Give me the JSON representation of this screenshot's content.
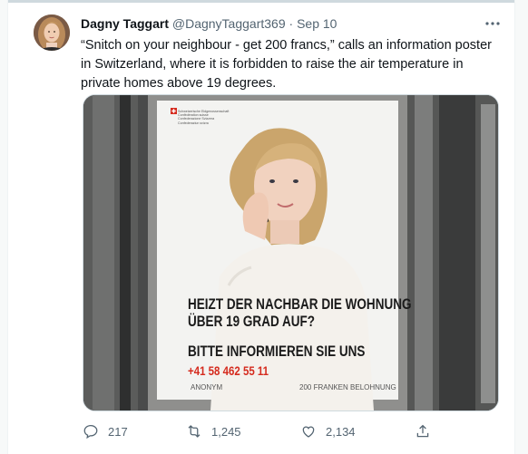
{
  "tweet": {
    "author_name": "Dagny Taggart",
    "author_handle": "@DagnyTaggart369",
    "separator": "·",
    "date": "Sep 10",
    "text": "“Snitch on  your neighbour - get 200 francs,” calls an information poster in Switzerland, where it is forbidden to raise the air temperature in private homes above 19 degrees."
  },
  "poster": {
    "agency_lines": [
      "Schweizerische Eidgenossenschaft",
      "Confédération suisse",
      "Confederazione Svizzera",
      "Confederaziun svizra"
    ],
    "headline_line1": "HEIZT DER NACHBAR DIE WOHNUNG",
    "headline_line2": "ÜBER 19 GRAD AUF?",
    "cta": "BITTE INFORMIEREN SIE UNS",
    "phone": "+41 58 462 55 11",
    "anonymous": "ANONYM",
    "reward": "200 FRANKEN BELOHNUNG"
  },
  "actions": {
    "reply_count": "217",
    "retweet_count": "1,245",
    "like_count": "2,134"
  },
  "colors": {
    "text_primary": "#0f1419",
    "text_secondary": "#536471",
    "swiss_red": "#d52b1e"
  },
  "icons": [
    "more-icon",
    "reply-icon",
    "retweet-icon",
    "like-icon",
    "share-icon"
  ]
}
